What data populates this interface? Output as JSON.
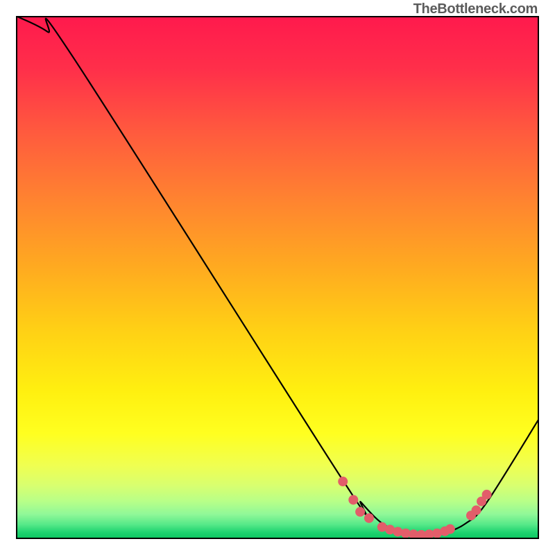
{
  "attribution": "TheBottleneck.com",
  "chart_data": {
    "type": "line",
    "title": "",
    "xlabel": "",
    "ylabel": "",
    "xlim": [
      0,
      100
    ],
    "ylim": [
      0,
      100
    ],
    "curve_points": [
      {
        "x": 0,
        "y": 100
      },
      {
        "x": 6,
        "y": 97
      },
      {
        "x": 11,
        "y": 92
      },
      {
        "x": 62,
        "y": 12
      },
      {
        "x": 66,
        "y": 7
      },
      {
        "x": 70,
        "y": 3
      },
      {
        "x": 74,
        "y": 1.2
      },
      {
        "x": 78,
        "y": 0.7
      },
      {
        "x": 82,
        "y": 1.2
      },
      {
        "x": 86,
        "y": 3
      },
      {
        "x": 90,
        "y": 7
      },
      {
        "x": 100,
        "y": 23
      }
    ],
    "markers": [
      {
        "x": 62.5,
        "y": 11
      },
      {
        "x": 64.5,
        "y": 7.5
      },
      {
        "x": 65.8,
        "y": 5.2
      },
      {
        "x": 67.5,
        "y": 4.0
      },
      {
        "x": 70.0,
        "y": 2.3
      },
      {
        "x": 71.5,
        "y": 1.8
      },
      {
        "x": 73.0,
        "y": 1.4
      },
      {
        "x": 74.5,
        "y": 1.1
      },
      {
        "x": 76.0,
        "y": 0.9
      },
      {
        "x": 77.5,
        "y": 0.8
      },
      {
        "x": 79.0,
        "y": 0.9
      },
      {
        "x": 80.5,
        "y": 1.1
      },
      {
        "x": 82.0,
        "y": 1.5
      },
      {
        "x": 83.0,
        "y": 1.9
      },
      {
        "x": 87.0,
        "y": 4.5
      },
      {
        "x": 88.0,
        "y": 5.5
      },
      {
        "x": 89.0,
        "y": 7.2
      },
      {
        "x": 90.0,
        "y": 8.5
      }
    ],
    "gradient_stops": [
      {
        "offset": 0.0,
        "color": "#ff1a4d"
      },
      {
        "offset": 0.1,
        "color": "#ff2f4a"
      },
      {
        "offset": 0.22,
        "color": "#ff5a3e"
      },
      {
        "offset": 0.35,
        "color": "#ff8330"
      },
      {
        "offset": 0.48,
        "color": "#ffaa20"
      },
      {
        "offset": 0.6,
        "color": "#ffd015"
      },
      {
        "offset": 0.72,
        "color": "#fff010"
      },
      {
        "offset": 0.8,
        "color": "#ffff20"
      },
      {
        "offset": 0.86,
        "color": "#f0ff50"
      },
      {
        "offset": 0.9,
        "color": "#d8ff70"
      },
      {
        "offset": 0.93,
        "color": "#b8ff88"
      },
      {
        "offset": 0.955,
        "color": "#90f898"
      },
      {
        "offset": 0.975,
        "color": "#55e888"
      },
      {
        "offset": 0.99,
        "color": "#1dd36f"
      },
      {
        "offset": 1.0,
        "color": "#0fc863"
      }
    ],
    "marker_color": "#e25d6a",
    "curve_color": "#000000"
  }
}
